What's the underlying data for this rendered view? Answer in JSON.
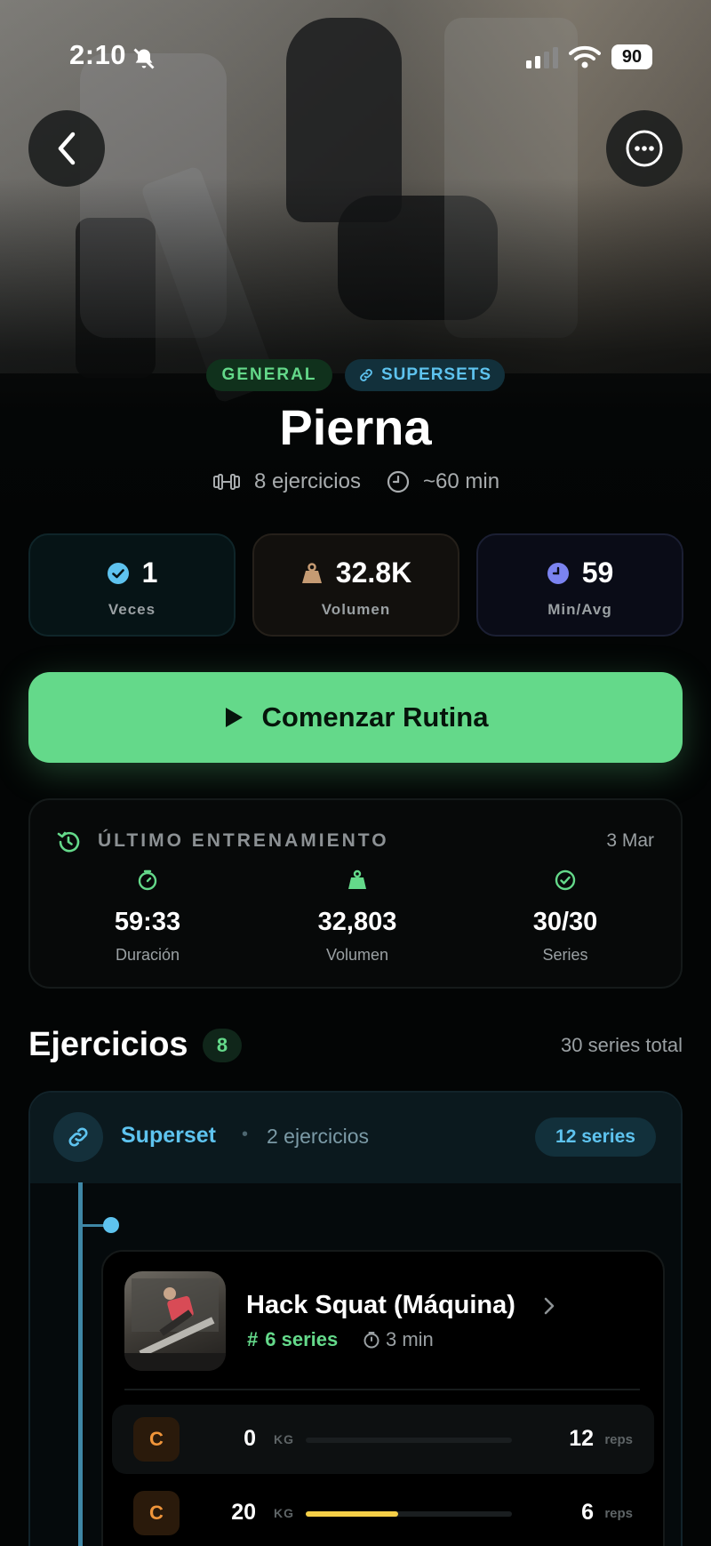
{
  "status_bar": {
    "time": "2:10",
    "battery": "90"
  },
  "hero": {
    "tags": [
      {
        "label": "GENERAL",
        "color": "#64d98a"
      },
      {
        "label": "SUPERSETS",
        "color": "#5ec3ef"
      }
    ],
    "title": "Pierna",
    "exercise_count": "8 ejercicios",
    "duration": "~60 min"
  },
  "stats": [
    {
      "value": "1",
      "label": "Veces",
      "icon": "check-circle-icon",
      "color": "#5ec3ef"
    },
    {
      "value": "32.8K",
      "label": "Volumen",
      "icon": "weight-icon",
      "color": "#c59b73"
    },
    {
      "value": "59",
      "label": "Min/Avg",
      "icon": "clock-icon",
      "color": "#7b83f0"
    }
  ],
  "start_button": {
    "label": "Comenzar Rutina"
  },
  "last_workout": {
    "title": "ÚLTIMO ENTRENAMIENTO",
    "date": "3 Mar",
    "metrics": [
      {
        "value": "59:33",
        "label": "Duración",
        "icon": "timer-icon"
      },
      {
        "value": "32,803",
        "label": "Volumen",
        "icon": "weight-icon"
      },
      {
        "value": "30/30",
        "label": "Series",
        "icon": "check-circle-icon"
      }
    ]
  },
  "exercises": {
    "title": "Ejercicios",
    "count": "8",
    "total": "30 series total"
  },
  "superset": {
    "label": "Superset",
    "separator": "•",
    "count": "2 ejercicios",
    "series": "12 series",
    "exercise": {
      "name": "Hack Squat (Máquina)",
      "hash": "#",
      "series": "6 series",
      "rest": "3 min",
      "sets": [
        {
          "type": "C",
          "kg": "0",
          "kg_unit": "KG",
          "reps": "12",
          "reps_unit": "reps",
          "load_fraction": 0
        },
        {
          "type": "C",
          "kg": "20",
          "kg_unit": "KG",
          "reps": "6",
          "reps_unit": "reps",
          "load_fraction": 0.45
        }
      ]
    }
  },
  "colors": {
    "accent_green": "#64d98a",
    "accent_blue": "#5ec3ef",
    "warmup_orange": "#f0953a",
    "load_yellow": "#f5cf47"
  }
}
